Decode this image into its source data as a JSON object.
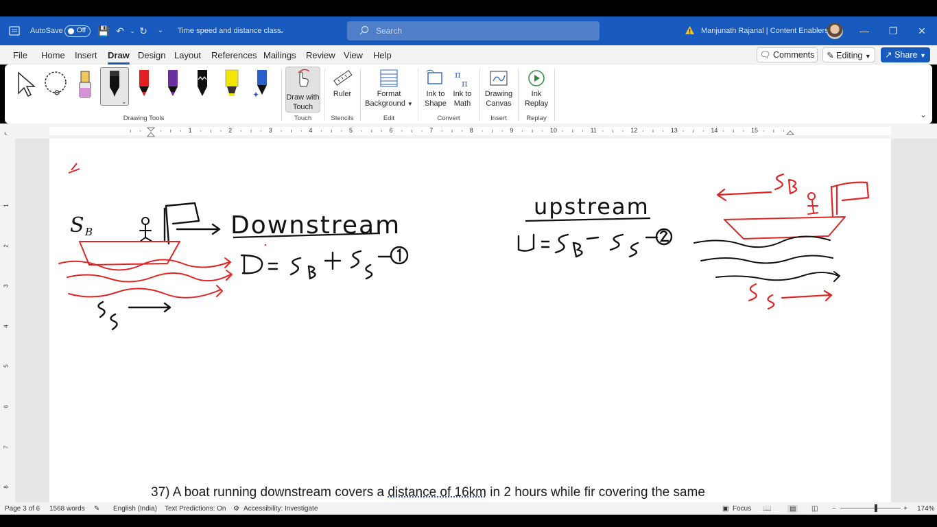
{
  "titlebar": {
    "autosave_label": "AutoSave",
    "autosave_state": "Off",
    "doc_title": "Time speed and distance class",
    "search_placeholder": "Search",
    "user": "Manjunath Rajanal | Content Enablers"
  },
  "menu": {
    "items": [
      "File",
      "Home",
      "Insert",
      "Draw",
      "Design",
      "Layout",
      "References",
      "Mailings",
      "Review",
      "View",
      "Help"
    ],
    "active": "Draw",
    "comments_label": "Comments",
    "editing_label": "Editing",
    "share_label": "Share"
  },
  "ribbon": {
    "groups": {
      "drawing_tools": "Drawing Tools",
      "touch": "Touch",
      "stencils": "Stencils",
      "edit": "Edit",
      "convert": "Convert",
      "insert": "Insert",
      "replay": "Replay"
    },
    "buttons": {
      "draw_with_touch_1": "Draw with",
      "draw_with_touch_2": "Touch",
      "ruler": "Ruler",
      "format_bg_1": "Format",
      "format_bg_2": "Background",
      "ink_to_shape_1": "Ink to",
      "ink_to_shape_2": "Shape",
      "ink_to_math_1": "Ink to",
      "ink_to_math_2": "Math",
      "drawing_canvas_1": "Drawing",
      "drawing_canvas_2": "Canvas",
      "ink_replay_1": "Ink",
      "ink_replay_2": "Replay"
    },
    "pen_colors": [
      "#e8e8e8",
      "#1a1a1a",
      "#e02020",
      "#6a2fa0",
      "#1a1a1a",
      "#f2e600",
      "#2a5fc9"
    ]
  },
  "ruler": {
    "numbers": [
      "1",
      "2",
      "3",
      "4",
      "5",
      "6",
      "7",
      "8",
      "9",
      "10",
      "11",
      "12",
      "13",
      "14",
      "15"
    ],
    "v_numbers": [
      "1",
      "2",
      "3",
      "4",
      "5",
      "6",
      "7",
      "8"
    ]
  },
  "document": {
    "line_pre": "37) A boat running downstream covers a ",
    "line_underlined": "distance of 16km",
    "line_post": " in 2 hours while fir covering the same",
    "ink_text": {
      "downstream": "Downstream",
      "upstream": "upstream"
    }
  },
  "status": {
    "page": "Page 3 of 6",
    "words": "1568 words",
    "language": "English (India)",
    "predictions": "Text Predictions: On",
    "accessibility": "Accessibility: Investigate",
    "focus": "Focus",
    "zoom": "174%"
  },
  "colors": {
    "brand": "#185abd",
    "ink_black": "#111111",
    "ink_red": "#e02424"
  }
}
